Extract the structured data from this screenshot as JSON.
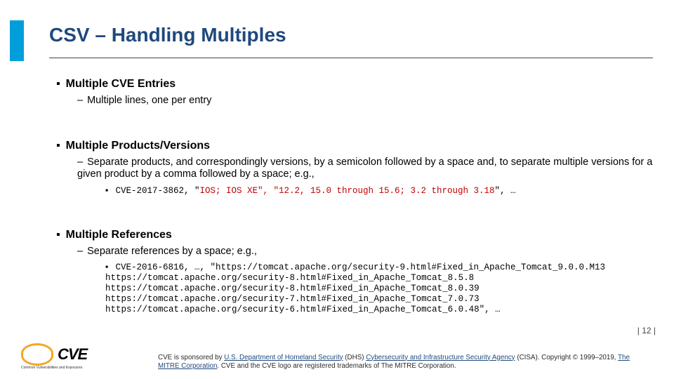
{
  "title": "CSV – Handling Multiples",
  "sections": [
    {
      "heading": "Multiple CVE Entries",
      "sub": "Multiple lines, one per entry"
    },
    {
      "heading": "Multiple Products/Versions",
      "sub": "Separate products, and correspondingly versions, by a semicolon followed by a space and, to separate multiple versions for a given product by a comma followed by a space; e.g.,",
      "code_pre": "CVE-2017-3862, \"",
      "code_red": "IOS; IOS XE\", \"12.2, 15.0 through 15.6; 3.2 through 3.18",
      "code_post": "\", …"
    },
    {
      "heading": "Multiple References",
      "sub": "Separate references by a space; e.g.,",
      "code_full": "CVE-2016-6816, …, \"https://tomcat.apache.org/security-9.html#Fixed_in_Apache_Tomcat_9.0.0.M13 https://tomcat.apache.org/security-8.html#Fixed_in_Apache_Tomcat_8.5.8 https://tomcat.apache.org/security-8.html#Fixed_in_Apache_Tomcat_8.0.39 https://tomcat.apache.org/security-7.html#Fixed_in_Apache_Tomcat_7.0.73 https://tomcat.apache.org/security-6.html#Fixed_in_Apache_Tomcat_6.0.48\", …"
    }
  ],
  "page_num": "| 12 |",
  "logo": {
    "alt": "CVE",
    "subtitle": "Common Vulnerabilities and Exposures"
  },
  "footer": {
    "line1_pre": "CVE is sponsored by ",
    "link1": "U.S. Department of Homeland Security",
    "line1_mid": " (DHS) ",
    "link2": "Cybersecurity and Infrastructure Security Agency",
    "line1_post": " (CISA). Copyright © 1999–2019, ",
    "link3": "The MITRE Corporation",
    "line2": ". CVE and the CVE logo are registered trademarks of The MITRE Corporation."
  }
}
